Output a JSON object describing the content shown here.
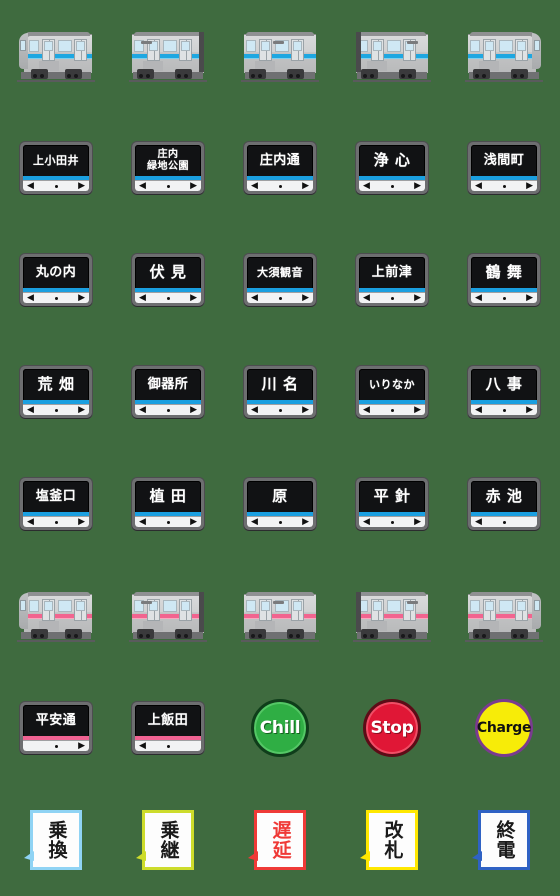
{
  "sheet": {
    "title": "Nagoya Subway Emoji Sheet",
    "background_color": "#3f6b3f",
    "columns": 5,
    "rows": 8
  },
  "colors": {
    "tsurumai_blue": "#1a9fe0",
    "kamiiida_pink": "#f06292",
    "chill_green": "#2fae44",
    "stop_red": "#e01736",
    "charge_yellow": "#f7ec08",
    "charge_ring_purple": "#7a3b8f",
    "note_lightblue": "#8fd3f4",
    "note_yellowgreen": "#cddc2b",
    "note_red": "#ef3a37",
    "note_yellow": "#ffe800",
    "note_blue": "#2f62c4"
  },
  "rows": [
    {
      "kind": "trains",
      "line_color": "#1a9fe0",
      "cells": [
        {
          "name": "train-car-cab-left",
          "variant": "cabL"
        },
        {
          "name": "train-car-coupled-right",
          "variant": "coupleR"
        },
        {
          "name": "train-car-middle",
          "variant": "middle"
        },
        {
          "name": "train-car-coupled-left",
          "variant": "coupleL"
        },
        {
          "name": "train-car-cab-right",
          "variant": "cabR"
        }
      ]
    },
    {
      "kind": "signs",
      "line_color": "#1a9fe0",
      "cells": [
        {
          "name": "kamiotai",
          "label": "上小田井",
          "size": "s3",
          "left": true,
          "right": true,
          "lines": 1
        },
        {
          "name": "shonai-ryokuchi-koen",
          "label": "庄内\n緑地公園",
          "size": "two-line",
          "left": true,
          "right": true,
          "lines": 2
        },
        {
          "name": "shonai-dori",
          "label": "庄内通",
          "size": "s2",
          "left": true,
          "right": true,
          "lines": 1
        },
        {
          "name": "joshin",
          "label": "浄 心",
          "size": "s1",
          "left": true,
          "right": true,
          "lines": 1
        },
        {
          "name": "sengencho",
          "label": "浅間町",
          "size": "s2",
          "left": true,
          "right": true,
          "lines": 1
        }
      ]
    },
    {
      "kind": "signs",
      "line_color": "#1a9fe0",
      "cells": [
        {
          "name": "marunouchi",
          "label": "丸の内",
          "size": "s2",
          "left": true,
          "right": true,
          "lines": 1
        },
        {
          "name": "fushimi",
          "label": "伏 見",
          "size": "s1",
          "left": true,
          "right": true,
          "lines": 1
        },
        {
          "name": "osu-kannon",
          "label": "大須観音",
          "size": "s3",
          "left": true,
          "right": true,
          "lines": 1
        },
        {
          "name": "kamimaezu",
          "label": "上前津",
          "size": "s2",
          "left": true,
          "right": true,
          "lines": 1
        },
        {
          "name": "tsurumai",
          "label": "鶴 舞",
          "size": "s1",
          "left": true,
          "right": true,
          "lines": 1
        }
      ]
    },
    {
      "kind": "signs",
      "line_color": "#1a9fe0",
      "cells": [
        {
          "name": "arahata",
          "label": "荒 畑",
          "size": "s1",
          "left": true,
          "right": true,
          "lines": 1
        },
        {
          "name": "gokiso",
          "label": "御器所",
          "size": "s2",
          "left": true,
          "right": true,
          "lines": 1
        },
        {
          "name": "kawana",
          "label": "川 名",
          "size": "s1",
          "left": true,
          "right": true,
          "lines": 1
        },
        {
          "name": "irinaka",
          "label": "いりなか",
          "size": "s3",
          "left": true,
          "right": true,
          "lines": 1
        },
        {
          "name": "yagoto",
          "label": "八 事",
          "size": "s1",
          "left": true,
          "right": true,
          "lines": 1
        }
      ]
    },
    {
      "kind": "signs",
      "line_color": "#1a9fe0",
      "cells": [
        {
          "name": "shiogamaguchi",
          "label": "塩釜口",
          "size": "s2",
          "left": true,
          "right": true,
          "lines": 1
        },
        {
          "name": "ueda",
          "label": "植 田",
          "size": "s1",
          "left": true,
          "right": true,
          "lines": 1
        },
        {
          "name": "hara",
          "label": "原",
          "size": "s1",
          "left": true,
          "right": true,
          "lines": 1
        },
        {
          "name": "hirabari",
          "label": "平 針",
          "size": "s1",
          "left": true,
          "right": true,
          "lines": 1
        },
        {
          "name": "akaike",
          "label": "赤 池",
          "size": "s1",
          "left": true,
          "right": false,
          "lines": 1
        }
      ]
    },
    {
      "kind": "trains",
      "line_color": "#f06292",
      "cells": [
        {
          "name": "train-car-cab-left",
          "variant": "cabL"
        },
        {
          "name": "train-car-coupled-right",
          "variant": "coupleR"
        },
        {
          "name": "train-car-middle",
          "variant": "middle"
        },
        {
          "name": "train-car-coupled-left",
          "variant": "coupleL"
        },
        {
          "name": "train-car-cab-right",
          "variant": "cabR"
        }
      ]
    },
    {
      "kind": "mixed",
      "line_color": "#f06292",
      "cells": [
        {
          "type": "sign",
          "name": "heian-dori",
          "label": "平安通",
          "size": "s2",
          "left": false,
          "right": true,
          "lines": 1,
          "line_color": "#f06292"
        },
        {
          "type": "sign",
          "name": "kamiiida",
          "label": "上飯田",
          "size": "s2",
          "left": true,
          "right": false,
          "lines": 1,
          "line_color": "#f06292"
        },
        {
          "type": "badge",
          "name": "chill-badge",
          "label": "Chill",
          "style": "chill"
        },
        {
          "type": "badge",
          "name": "stop-badge",
          "label": "Stop",
          "style": "stop"
        },
        {
          "type": "badge",
          "name": "charge-badge",
          "label": "Charge",
          "style": "charge"
        }
      ]
    },
    {
      "kind": "notes",
      "cells": [
        {
          "name": "note-norikae",
          "label": "乗換",
          "style": "b-lightblue"
        },
        {
          "name": "note-noritsugi",
          "label": "乗継",
          "style": "b-yellowgreen"
        },
        {
          "name": "note-chien",
          "label": "遅延",
          "style": "b-red"
        },
        {
          "name": "note-kaisatsu",
          "label": "改札",
          "style": "b-yellow"
        },
        {
          "name": "note-shuden",
          "label": "終電",
          "style": "b-blue"
        }
      ]
    }
  ],
  "arrow_glyphs": {
    "left": "◀",
    "right": "▶"
  }
}
